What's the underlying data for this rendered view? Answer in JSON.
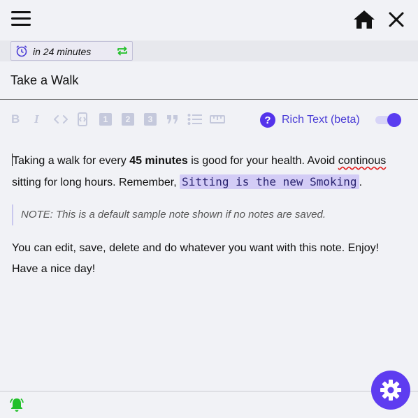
{
  "header": {
    "menu_icon": "hamburger-menu-icon",
    "home_icon": "home-icon",
    "close_icon": "close-icon"
  },
  "reminder": {
    "text": "in 24 minutes",
    "alarm_icon": "alarm-clock-icon",
    "repeat_icon": "repeat-icon",
    "repeat_color": "#22c02a"
  },
  "note": {
    "title": "Take a Walk",
    "body": {
      "p1_before": "Taking a walk for every ",
      "p1_bold": "45 minutes",
      "p1_mid": " is good for your health. Avoid ",
      "p1_misspelled": "continous",
      "p1_after": " sitting for long hours. Remember, ",
      "p1_code": "Sitting is the new Smoking",
      "p1_end": ".",
      "quote": "NOTE: This is a default sample note shown if no notes are saved.",
      "p2": "You can edit, save, delete and do whatever you want with this note. Enjoy!",
      "p3": "Have a nice day!"
    }
  },
  "toolbar": {
    "bold": "B",
    "italic": "I",
    "h1": "1",
    "h2": "2",
    "h3": "3",
    "rich_text_label": "Rich Text (beta)",
    "rich_text_enabled": true,
    "accent": "#5433eb"
  },
  "footer": {
    "bell_icon": "notification-bell-icon",
    "bell_color": "#22c02a",
    "settings_icon": "gear-icon",
    "settings_color": "#5e3cf0"
  }
}
